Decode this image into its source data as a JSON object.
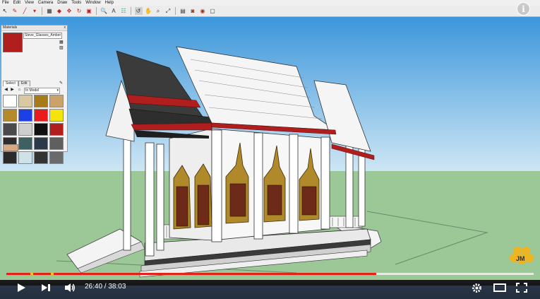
{
  "menu": [
    "File",
    "Edit",
    "View",
    "Camera",
    "Draw",
    "Tools",
    "Window",
    "Help"
  ],
  "toolbar_icons": [
    "select-tool-icon",
    "paint-tool-icon",
    "pencil-tool-icon",
    "eraser-tool-icon",
    "rectangle-tool-icon",
    "push-pull-icon",
    "move-icon",
    "rotate-icon",
    "offset-icon",
    "follow-me-icon",
    "tape-measure-icon",
    "text-icon",
    "axes-icon",
    "orbit-icon",
    "pan-icon",
    "zoom-icon",
    "zoom-extents-icon",
    "components-icon",
    "styles-icon",
    "materials-icon"
  ],
  "info_glyph": "i",
  "materials_panel": {
    "title": "Materials",
    "close_glyph": "x",
    "material_name": "Steve_Glasses_Amber",
    "tabs": [
      "Select",
      "Edit"
    ],
    "dropdown": "In Model",
    "swatches": [
      "#ffffff",
      "#d9c9a3",
      "#a87b1a",
      "#caa26a",
      "#b58a2a",
      "#1c3fe8",
      "#e81c1c",
      "#f2e40c",
      "#4a4a4a",
      "#cfcfcf",
      "#101010",
      "#b01e1e",
      "#2d2d2d",
      "#3d6060",
      "#2b3a4a",
      "#5f5f5f",
      "#2a2a2a",
      "#cfe2e8",
      "#333333",
      "#6a6a6a"
    ]
  },
  "video": {
    "current_time": "26:40",
    "total_time": "38:03",
    "time_text": "26:40 / 38:03",
    "played_fraction": 0.702,
    "buffered_fraction": 0.33,
    "ad_markers": [
      0.045,
      0.085
    ],
    "buttons": [
      "play-icon",
      "next-icon",
      "volume-icon",
      "settings-icon",
      "theater-icon",
      "fullscreen-icon"
    ]
  },
  "watermark": "JM",
  "colors": {
    "sky": "#3d9de0",
    "ground": "#9cc796",
    "accent": "#e62117",
    "roof_red": "#b01e1e"
  }
}
